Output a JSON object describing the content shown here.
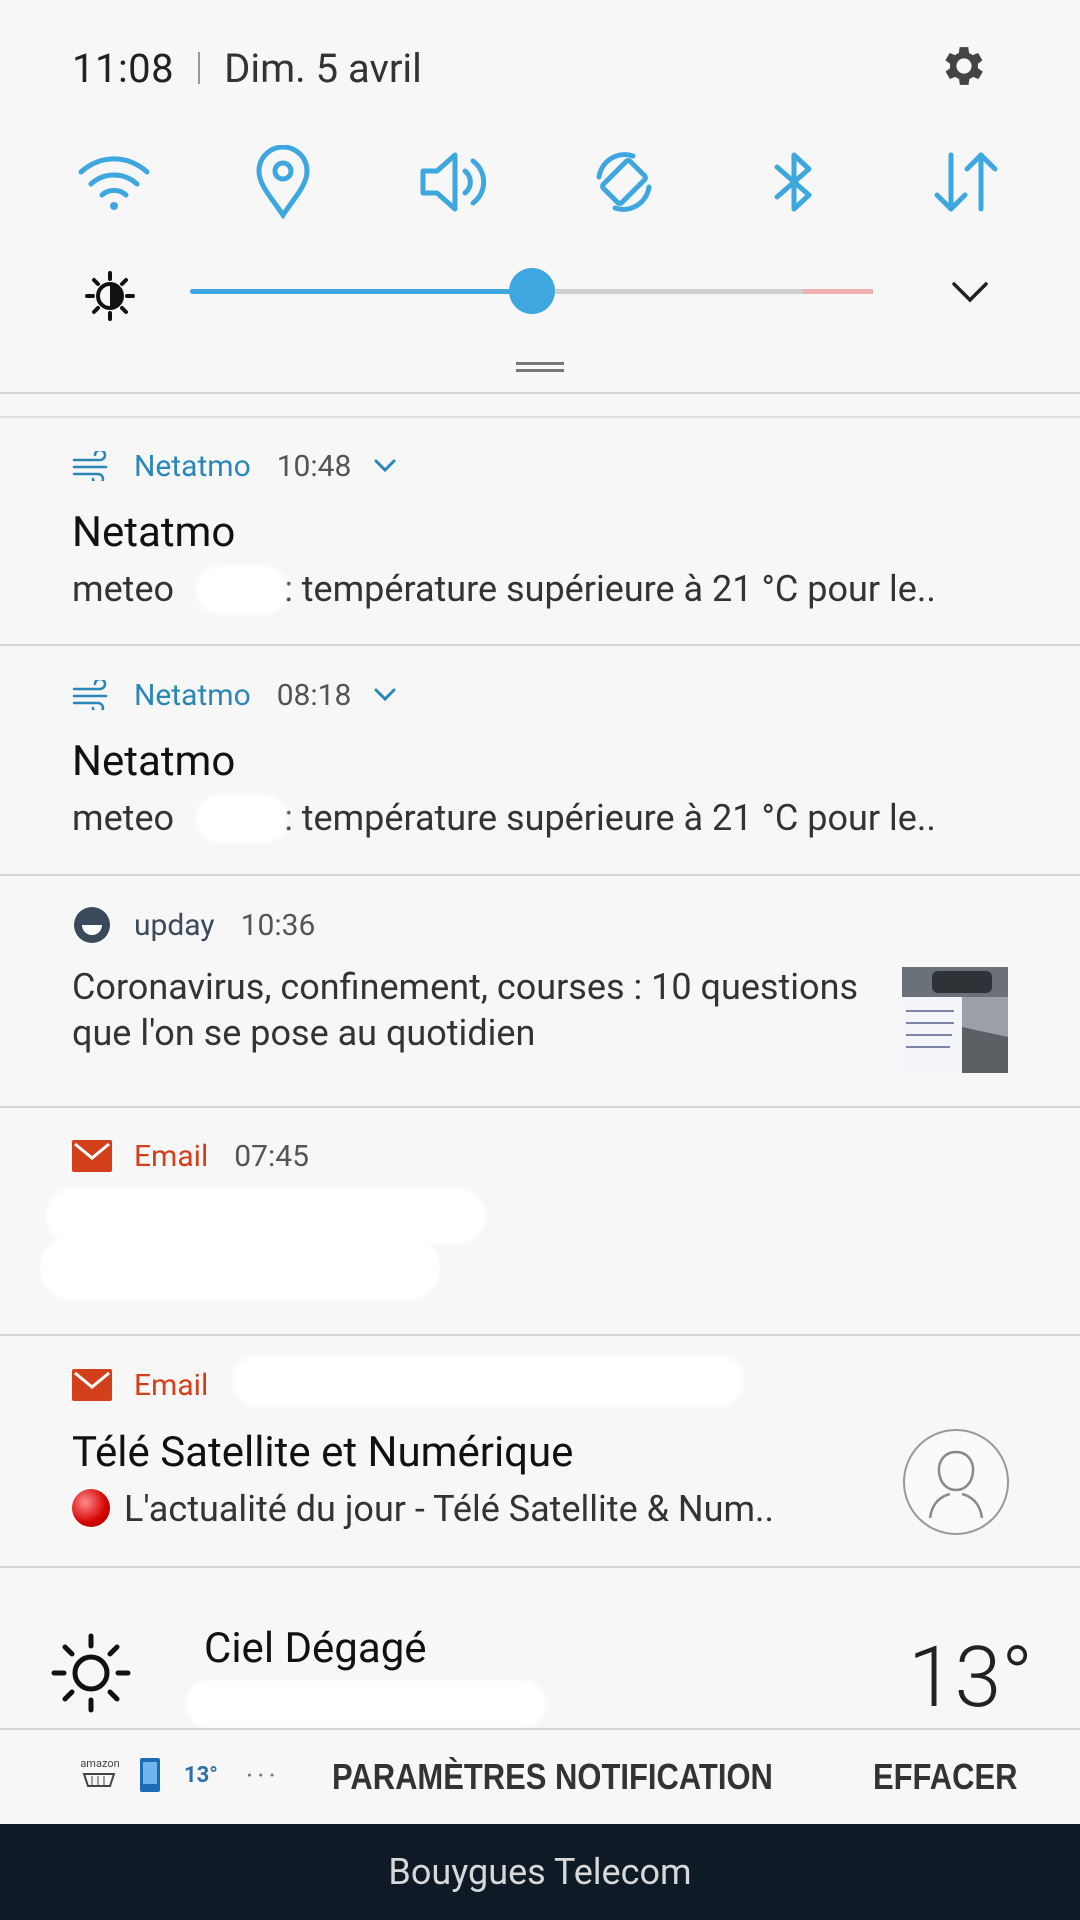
{
  "status": {
    "time": "11:08",
    "date": "Dim. 5 avril"
  },
  "quick_settings": {
    "toggles": [
      {
        "icon": "wifi-icon"
      },
      {
        "icon": "location-icon"
      },
      {
        "icon": "sound-icon"
      },
      {
        "icon": "auto-rotate-icon"
      },
      {
        "icon": "bluetooth-icon"
      },
      {
        "icon": "mobile-data-icon"
      }
    ],
    "brightness_level": 0.5,
    "accent": "#3ea7e0"
  },
  "notifications": [
    {
      "app": "Netatmo",
      "time": "10:48",
      "title": "Netatmo",
      "text_prefix": "meteo",
      "text": ": température supérieure à 21 °C pour le..",
      "color": "#2a87b8"
    },
    {
      "app": "Netatmo",
      "time": "08:18",
      "title": "Netatmo",
      "text_prefix": "meteo",
      "text": ": température supérieure à 21 °C pour le..",
      "color": "#2a87b8"
    },
    {
      "app": "upday",
      "time": "10:36",
      "text": "Coronavirus, confinement, courses : 10 questions que l'on se pose au quotidien",
      "color": "#3a4a5a"
    },
    {
      "app": "Email",
      "time": "07:45",
      "color": "#d23f1a"
    },
    {
      "app": "Email",
      "title": "Télé Satellite et Numérique",
      "text": "L'actualité du jour - Télé Satellite & Num..",
      "color": "#d23f1a"
    }
  ],
  "weather": {
    "condition": "Ciel Dégagé",
    "temperature": "13°"
  },
  "bottom_bar": {
    "amazon_label": "amazon",
    "temp": "13°",
    "more": "···",
    "settings_label": "PARAMÈTRES NOTIFICATION",
    "clear_label": "EFFACER"
  },
  "carrier": "Bouygues Telecom"
}
